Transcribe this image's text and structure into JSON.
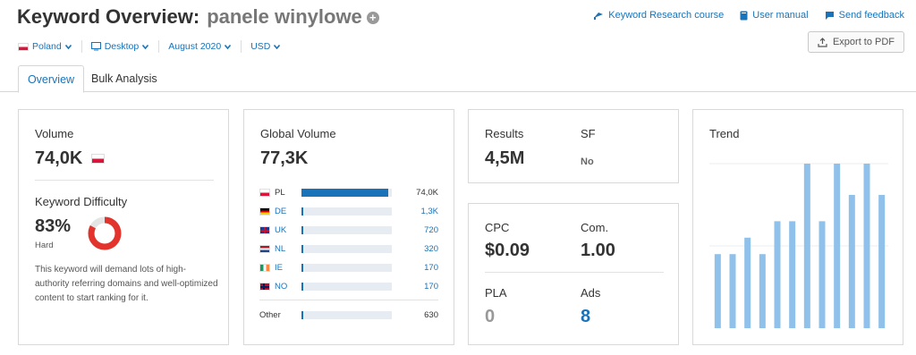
{
  "header": {
    "title": "Keyword Overview:",
    "keyword": "panele winylowe",
    "links": {
      "research_course": "Keyword Research course",
      "user_manual": "User manual",
      "send_feedback": "Send feedback"
    },
    "export_label": "Export to PDF"
  },
  "filters": {
    "country": "Poland",
    "device": "Desktop",
    "date": "August 2020",
    "currency": "USD"
  },
  "tabs": [
    {
      "label": "Overview",
      "active": true
    },
    {
      "label": "Bulk Analysis",
      "active": false
    }
  ],
  "volume_card": {
    "volume_label": "Volume",
    "volume_value": "74,0K",
    "kd_label": "Keyword Difficulty",
    "kd_value": "83%",
    "kd_percent": 83,
    "kd_level": "Hard",
    "description": "This keyword will demand lots of high-authority referring domains and well-optimized content to start ranking for it."
  },
  "global_card": {
    "label": "Global Volume",
    "value": "77,3K",
    "rows": [
      {
        "code": "PL",
        "value": "74,0K",
        "fill": 0.96
      },
      {
        "code": "DE",
        "value": "1,3K",
        "fill": 0.02
      },
      {
        "code": "UK",
        "value": "720",
        "fill": 0.02
      },
      {
        "code": "NL",
        "value": "320",
        "fill": 0.02
      },
      {
        "code": "IE",
        "value": "170",
        "fill": 0.02
      },
      {
        "code": "NO",
        "value": "170",
        "fill": 0.02
      }
    ],
    "other": {
      "label": "Other",
      "value": "630",
      "fill": 0.02
    }
  },
  "results_card": {
    "results_label": "Results",
    "results_value": "4,5M",
    "sf_label": "SF",
    "sf_value": "No"
  },
  "cpc_card": {
    "cpc_label": "CPC",
    "cpc_value": "$0.09",
    "com_label": "Com.",
    "com_value": "1.00",
    "pla_label": "PLA",
    "pla_value": "0",
    "ads_label": "Ads",
    "ads_value": "8"
  },
  "trend_card": {
    "label": "Trend"
  },
  "chart_data": {
    "type": "bar",
    "title": "Trend",
    "values": [
      0.45,
      0.45,
      0.55,
      0.45,
      0.65,
      0.65,
      1.0,
      0.65,
      1.0,
      0.81,
      1.0,
      0.81
    ],
    "ylim": [
      0,
      1
    ],
    "grid": true,
    "color": "#8fc1ea"
  },
  "colors": {
    "accent": "#1a73b8",
    "kd_red": "#e2332c",
    "trend_bar": "#8fc1ea"
  }
}
